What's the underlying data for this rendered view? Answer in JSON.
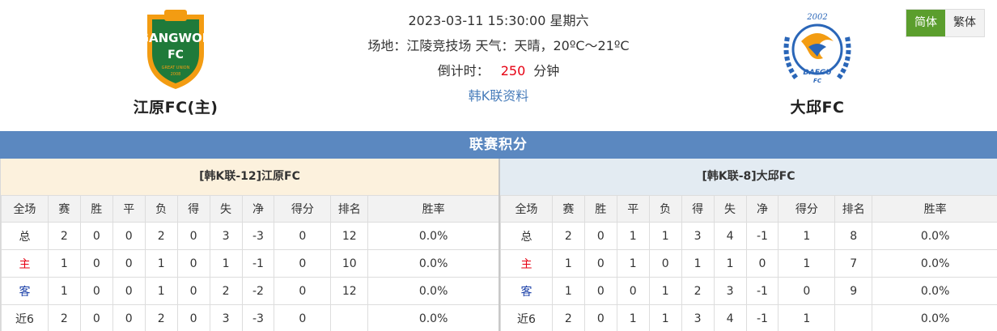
{
  "header": {
    "datetime": "2023-03-11 15:30:00 星期六",
    "venue_weather": "场地：江陵竞技场 天气：天晴，20ºC～21ºC",
    "countdown_label": "倒计时：",
    "countdown_value": "250",
    "countdown_unit": "分钟",
    "league_link": "韩K联资料"
  },
  "home_team": {
    "name": "江原FC(主)",
    "logo_text_top": "GANGWON",
    "logo_text_fc": "FC",
    "logo_text_sub": "GREAT UNION",
    "logo_text_year": "2008",
    "color": "#f39c12"
  },
  "away_team": {
    "name": "大邱FC",
    "logo_text_year": "2002",
    "logo_text_name": "DAEGU",
    "logo_text_fc": "FC",
    "color": "#2a66b8"
  },
  "lang": {
    "simplified": "简体",
    "traditional": "繁体"
  },
  "section_title": "联赛积分",
  "columns": [
    "全场",
    "赛",
    "胜",
    "平",
    "负",
    "得",
    "失",
    "净",
    "得分",
    "排名",
    "胜率"
  ],
  "left_table": {
    "title": "[韩K联-12]江原FC",
    "rows": [
      [
        "总",
        "2",
        "0",
        "0",
        "2",
        "0",
        "3",
        "-3",
        "0",
        "12",
        "0.0%"
      ],
      [
        "主",
        "1",
        "0",
        "0",
        "1",
        "0",
        "1",
        "-1",
        "0",
        "10",
        "0.0%"
      ],
      [
        "客",
        "1",
        "0",
        "0",
        "1",
        "0",
        "2",
        "-2",
        "0",
        "12",
        "0.0%"
      ],
      [
        "近6",
        "2",
        "0",
        "0",
        "2",
        "0",
        "3",
        "-3",
        "0",
        "",
        "0.0%"
      ]
    ]
  },
  "right_table": {
    "title": "[韩K联-8]大邱FC",
    "rows": [
      [
        "总",
        "2",
        "0",
        "1",
        "1",
        "3",
        "4",
        "-1",
        "1",
        "8",
        "0.0%"
      ],
      [
        "主",
        "1",
        "0",
        "1",
        "0",
        "1",
        "1",
        "0",
        "1",
        "7",
        "0.0%"
      ],
      [
        "客",
        "1",
        "0",
        "0",
        "1",
        "2",
        "3",
        "-1",
        "0",
        "9",
        "0.0%"
      ],
      [
        "近6",
        "2",
        "0",
        "1",
        "1",
        "3",
        "4",
        "-1",
        "1",
        "",
        "0.0%"
      ]
    ]
  }
}
